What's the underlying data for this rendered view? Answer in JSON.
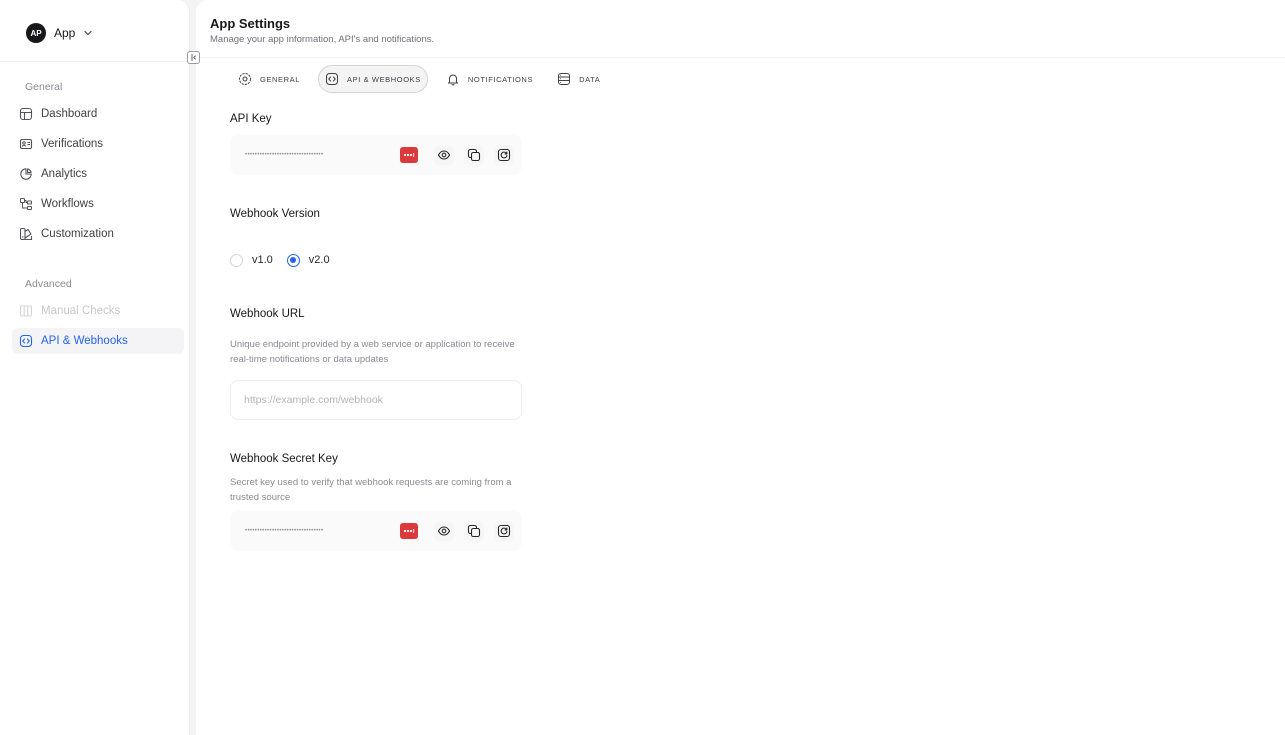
{
  "app_switcher": {
    "avatar": "AP",
    "name": "App",
    "icon": "chevron-down-icon"
  },
  "sidebar": {
    "general_label": "General",
    "general_items": [
      {
        "label": "Dashboard",
        "icon": "layout-icon"
      },
      {
        "label": "Verifications",
        "icon": "id-card-icon"
      },
      {
        "label": "Analytics",
        "icon": "pie-chart-icon"
      },
      {
        "label": "Workflows",
        "icon": "workflow-icon"
      },
      {
        "label": "Customization",
        "icon": "palette-icon"
      }
    ],
    "advanced_label": "Advanced",
    "advanced_items": [
      {
        "label": "Manual Checks",
        "icon": "columns-icon",
        "state": "disabled"
      },
      {
        "label": "API & Webhooks",
        "icon": "code-icon",
        "state": "active"
      }
    ]
  },
  "header": {
    "title": "App Settings",
    "subtitle": "Manage your app information, API's and notifications."
  },
  "tabs": [
    {
      "label": "GENERAL",
      "icon": "settings-icon"
    },
    {
      "label": "API & WEBHOOKS",
      "icon": "code-icon",
      "active": true
    },
    {
      "label": "NOTIFICATIONS",
      "icon": "bell-icon"
    },
    {
      "label": "DATA",
      "icon": "database-icon"
    }
  ],
  "api_key": {
    "label": "API Key",
    "masked_value": "••••••••••••••••••••••••••••••••"
  },
  "webhook_version": {
    "label": "Webhook Version",
    "options": [
      "v1.0",
      "v2.0"
    ],
    "selected": "v2.0"
  },
  "webhook_url": {
    "label": "Webhook URL",
    "help": "Unique endpoint provided by a web service or application to receive real-time notifications or data updates",
    "value": "",
    "placeholder": "https://example.com/webhook"
  },
  "webhook_secret": {
    "label": "Webhook Secret Key",
    "help": "Secret key used to verify that webhook requests are coming from a trusted source",
    "masked_value": "••••••••••••••••••••••••••••••••"
  },
  "colors": {
    "accent": "#2563eb",
    "password_badge": "#dc3a3a"
  }
}
